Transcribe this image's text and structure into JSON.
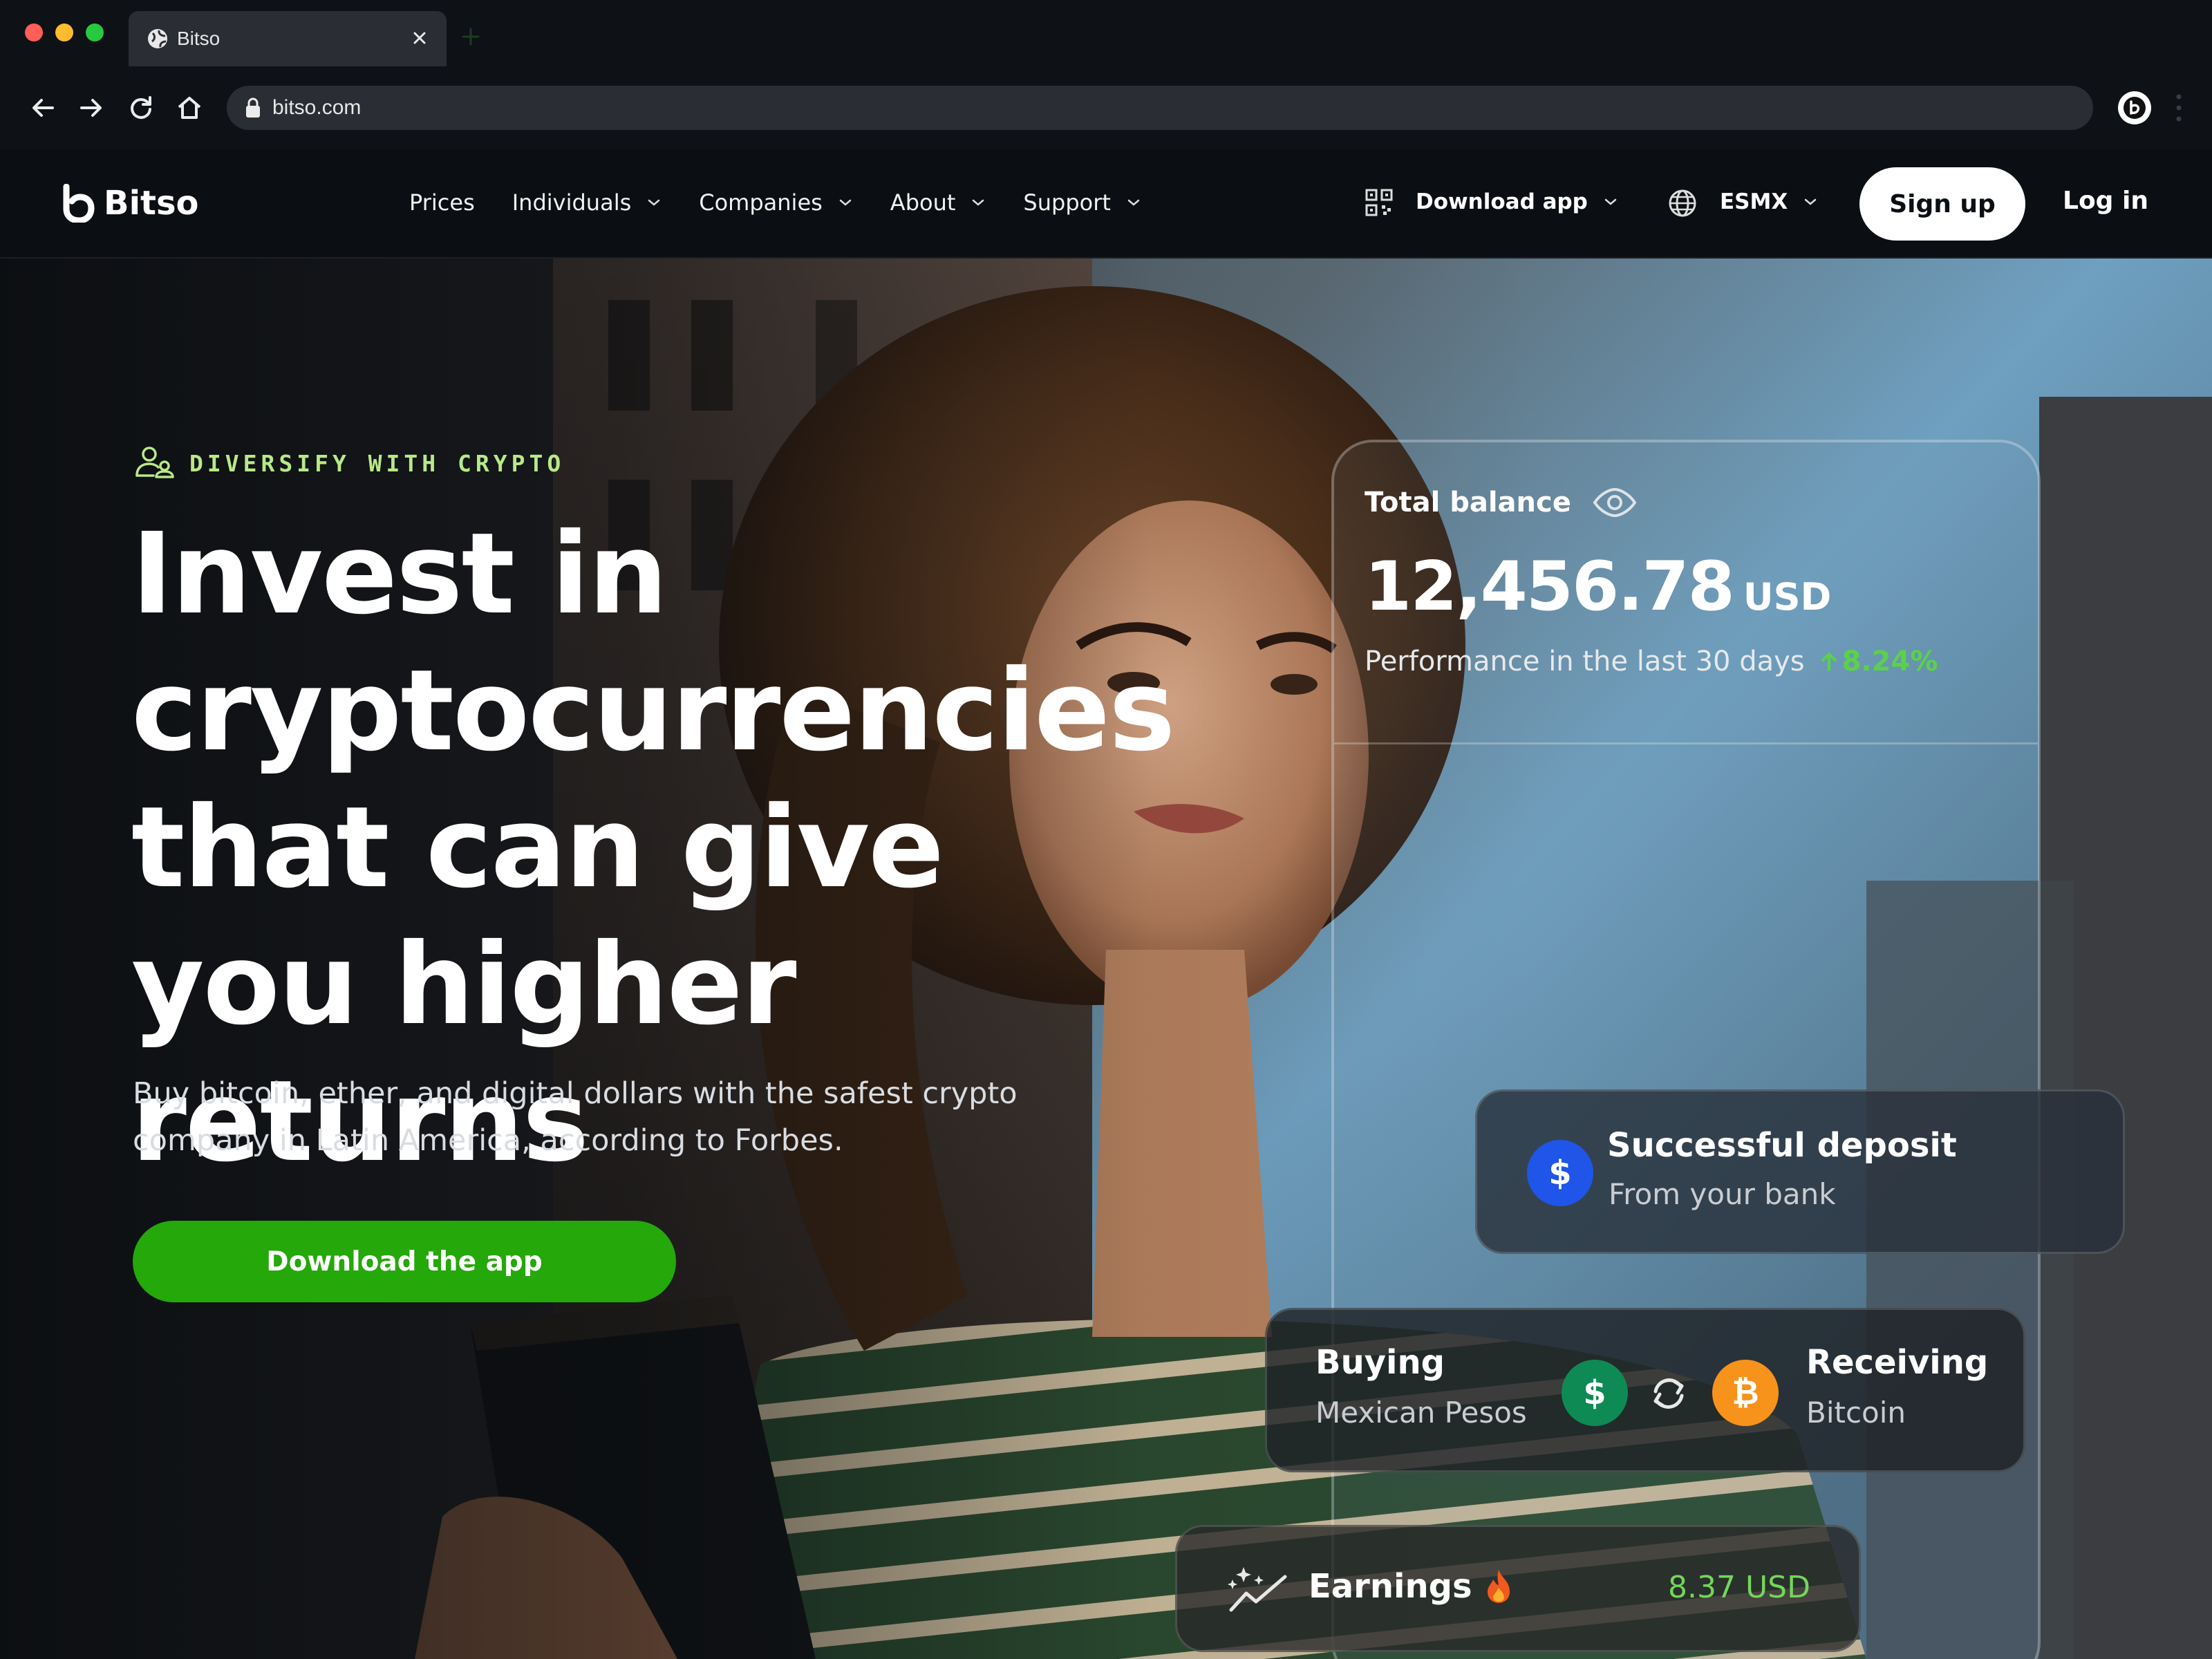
{
  "browser": {
    "tab_title": "Bitso",
    "url": "bitso.com"
  },
  "nav": {
    "logo_text": "Bitso",
    "menu": [
      {
        "label": "Prices",
        "dropdown": false
      },
      {
        "label": "Individuals",
        "dropdown": true
      },
      {
        "label": "Companies",
        "dropdown": true
      },
      {
        "label": "About",
        "dropdown": true
      },
      {
        "label": "Support",
        "dropdown": true
      }
    ],
    "download_app": "Download app",
    "region": "ESMX",
    "sign_up": "Sign up",
    "log_in": "Log in"
  },
  "hero": {
    "eyebrow": "DIVERSIFY WITH CRYPTO",
    "headline": "Invest in cryptocurrencies that can give you higher returns",
    "subtext": "Buy bitcoin, ether, and digital dollars with the safest crypto company in Latin America, according to Forbes.",
    "cta": "Download the app"
  },
  "balance": {
    "label": "Total balance",
    "amount": "12,456.78",
    "currency": "USD",
    "performance_label": "Performance in the last 30 days",
    "performance_value": "8.24%"
  },
  "deposit": {
    "title": "Successful deposit",
    "subtitle": "From your bank",
    "coin_symbol": "$"
  },
  "exchange": {
    "buying_label": "Buying",
    "buying_asset": "Mexican Pesos",
    "receiving_label": "Receiving",
    "receiving_asset": "Bitcoin",
    "from_symbol": "$",
    "to_symbol": "₿"
  },
  "earnings": {
    "label": "Earnings",
    "value": "8.37 USD"
  },
  "colors": {
    "accent_green": "#24a80a",
    "eyebrow_green": "#b8e986",
    "positive_green": "#5bd14a",
    "deposit_blue": "#1f55e8",
    "peso_green": "#0e8a55",
    "bitcoin_orange": "#f7931a"
  },
  "icons": [
    "globe-icon",
    "close-icon",
    "back-icon",
    "forward-icon",
    "reload-icon",
    "home-icon",
    "lock-icon",
    "qr-code-icon",
    "chevron-down-icon",
    "user-group-icon",
    "eye-icon",
    "arrow-up-icon",
    "swap-icon",
    "sparkle-chart-icon",
    "fire-icon"
  ]
}
